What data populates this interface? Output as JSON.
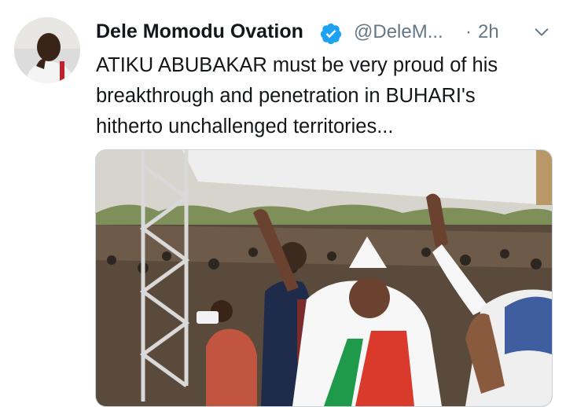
{
  "tweet": {
    "author_name": "Dele Momodu Ovation",
    "handle": "@DeleM...",
    "separator": "·",
    "time": "2h",
    "text": "ATIKU ABUBAKAR must be very proud of his breakthrough and penetration in BUHARI's hitherto unchallenged territories..."
  },
  "icons": {
    "verified": "verified-badge-icon",
    "more": "chevron-down-icon"
  },
  "colors": {
    "verified_blue": "#1da1f2",
    "secondary_text": "#657786",
    "primary_text": "#14171a",
    "border": "#ccd6dd"
  }
}
